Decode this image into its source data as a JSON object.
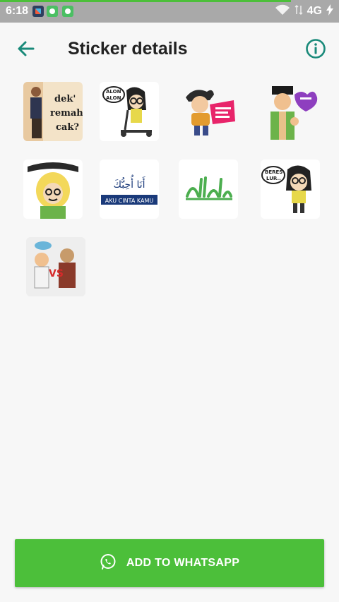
{
  "status_bar": {
    "time": "6:18",
    "network": "4G",
    "icons": [
      "app-notification-icon",
      "app-notification-icon",
      "app-notification-icon",
      "wifi-icon",
      "data-arrows-icon",
      "battery-charging-icon"
    ]
  },
  "app_bar": {
    "title": "Sticker details",
    "back_icon": "arrow-back-icon",
    "info_icon": "info-icon"
  },
  "stickers": [
    {
      "name": "sticker-dek-remah-cak",
      "text_lines": [
        "dek'",
        "remah",
        "cak?"
      ]
    },
    {
      "name": "sticker-alon-alon",
      "text_lines": [
        "ALON",
        "ALON"
      ]
    },
    {
      "name": "sticker-boy-speech",
      "text_lines": []
    },
    {
      "name": "sticker-man-thumbs-up",
      "text_lines": []
    },
    {
      "name": "sticker-assalamualaikum",
      "text_lines": []
    },
    {
      "name": "sticker-aku-cinta-kamu",
      "text_lines": [
        "أَنَا أُحِبُّكَ",
        "AKU CINTA KAMU"
      ]
    },
    {
      "name": "sticker-allahu-akbar",
      "text_lines": []
    },
    {
      "name": "sticker-beres-lur",
      "text_lines": [
        "BERES",
        "LUR.."
      ]
    },
    {
      "name": "sticker-vs",
      "text_lines": [
        "VS"
      ]
    }
  ],
  "add_button": {
    "label": "ADD TO WHATSAPP",
    "icon": "whatsapp-icon"
  },
  "colors": {
    "accent": "#1a8a7a",
    "button": "#4cbf3a",
    "status_bar": "#a9a9a9"
  }
}
